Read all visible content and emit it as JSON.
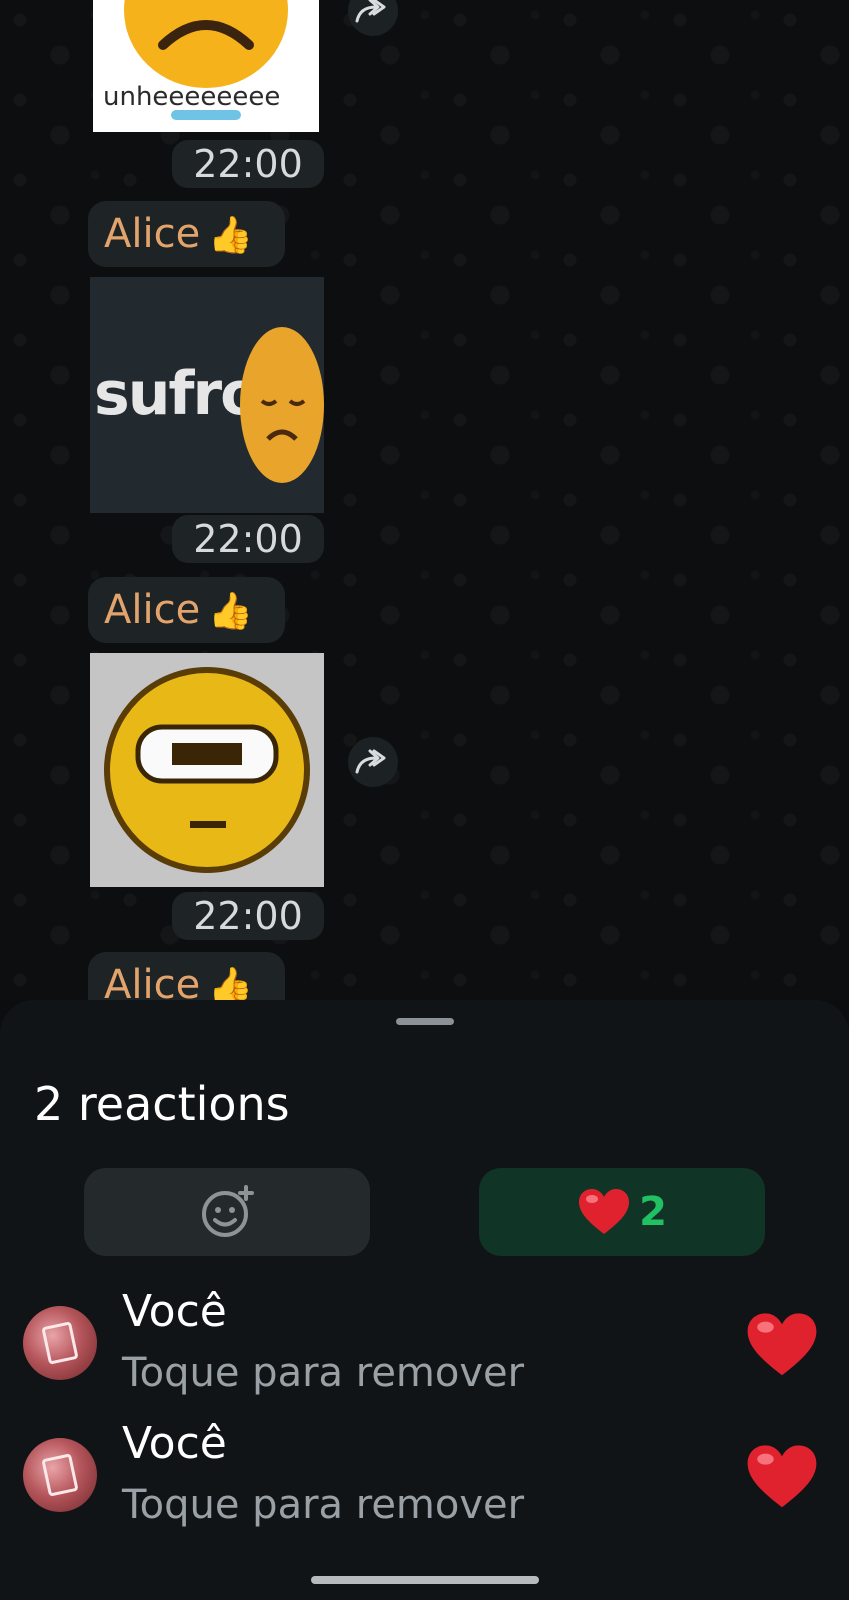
{
  "chat": {
    "messages": [
      {
        "kind": "image",
        "image_text": "unheeeeeeee",
        "time": "22:00",
        "forwardable": true
      },
      {
        "kind": "image",
        "image_text": "sufro",
        "time": "22:00",
        "forwardable": false
      },
      {
        "kind": "image",
        "image_text": "",
        "time": "22:00",
        "forwardable": true
      }
    ],
    "senders": [
      {
        "name": "Alice",
        "icon": "thumbs-up-icon"
      },
      {
        "name": "Alice",
        "icon": "thumbs-up-icon"
      },
      {
        "name": "Alice",
        "icon": "thumbs-up-icon"
      }
    ]
  },
  "sheet": {
    "title": "2 reactions",
    "tabs": [
      {
        "icon": "add-reaction-icon",
        "label": ""
      },
      {
        "icon": "heart-icon",
        "count": "2"
      }
    ],
    "reactions": [
      {
        "name": "Você",
        "subtitle": "Toque para remover",
        "icon": "heart-icon"
      },
      {
        "name": "Você",
        "subtitle": "Toque para remover",
        "icon": "heart-icon"
      }
    ]
  },
  "colors": {
    "sender_name": "#e3a46c",
    "heart": "#e0222f",
    "count_green": "#21c063",
    "active_tab": "#103426"
  }
}
